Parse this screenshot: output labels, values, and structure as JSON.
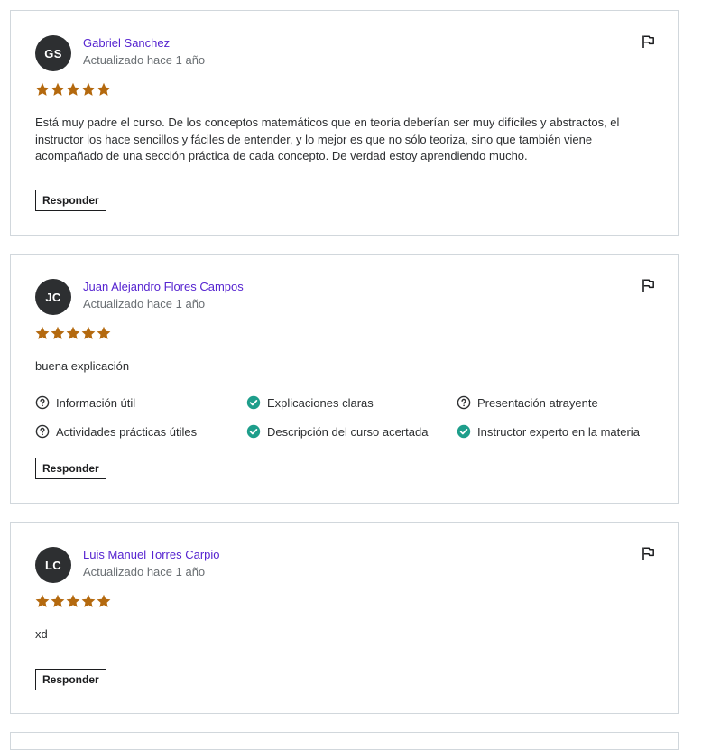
{
  "reviews": [
    {
      "initials": "GS",
      "name": "Gabriel Sanchez",
      "updated": "Actualizado hace 1 año",
      "rating": 5,
      "text": "Está muy padre el curso. De los conceptos matemáticos que en teoría deberían ser muy difíciles y abstractos, el instructor los hace sencillos y fáciles de entender, y lo mejor es que no sólo teoriza, sino que también viene acompañado de una sección práctica de cada concepto. De verdad estoy aprendiendo mucho.",
      "reply_label": "Responder"
    },
    {
      "initials": "JC",
      "name": "Juan Alejandro Flores Campos",
      "updated": "Actualizado hace 1 año",
      "rating": 5,
      "text": "buena explicación",
      "tags": [
        {
          "label": "Información útil",
          "icon": "question-circle-icon"
        },
        {
          "label": "Explicaciones claras",
          "icon": "check-circle-icon"
        },
        {
          "label": "Presentación atrayente",
          "icon": "question-circle-icon"
        },
        {
          "label": "Actividades prácticas útiles",
          "icon": "question-circle-icon"
        },
        {
          "label": "Descripción del curso acertada",
          "icon": "check-circle-icon"
        },
        {
          "label": "Instructor experto en la materia",
          "icon": "check-circle-icon"
        }
      ],
      "reply_label": "Responder"
    },
    {
      "initials": "LC",
      "name": "Luis Manuel Torres Carpio",
      "updated": "Actualizado hace 1 año",
      "rating": 5,
      "text": "xd",
      "reply_label": "Responder"
    }
  ],
  "colors": {
    "name_link": "#5624d0",
    "star": "#b4690e",
    "check": "#1e9e8b",
    "avatar_bg": "#2d2f31"
  }
}
